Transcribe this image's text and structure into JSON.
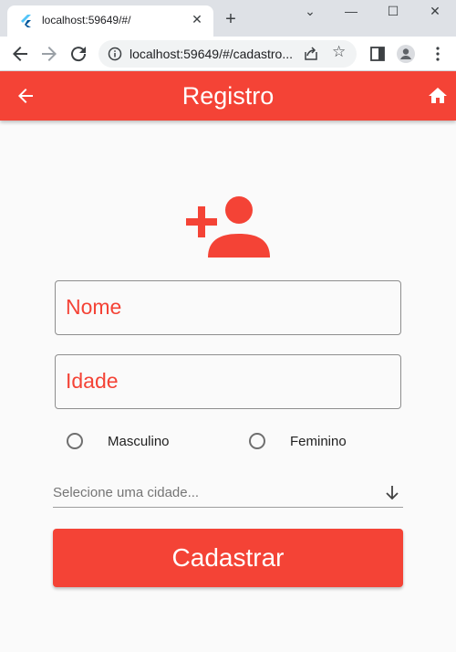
{
  "browser": {
    "tab_title": "localhost:59649/#/",
    "tab_close": "✕",
    "new_tab": "+",
    "url": "localhost:59649/#/cadastro...",
    "window_controls": {
      "minimize": "—",
      "maximize": "☐",
      "close": "✕",
      "dropdown": "⌄"
    }
  },
  "appbar": {
    "title": "Registro",
    "back_icon": "arrow-back-icon",
    "home_icon": "home-icon"
  },
  "form": {
    "header_icon": "person-add-icon",
    "name_label": "Nome",
    "age_label": "Idade",
    "gender_options": [
      {
        "label": "Masculino",
        "selected": false
      },
      {
        "label": "Feminino",
        "selected": false
      }
    ],
    "city_hint": "Selecione uma cidade...",
    "submit_label": "Cadastrar"
  },
  "colors": {
    "primary": "#f44336",
    "background": "#fafafa",
    "text": "#212121",
    "hint": "#757575"
  }
}
